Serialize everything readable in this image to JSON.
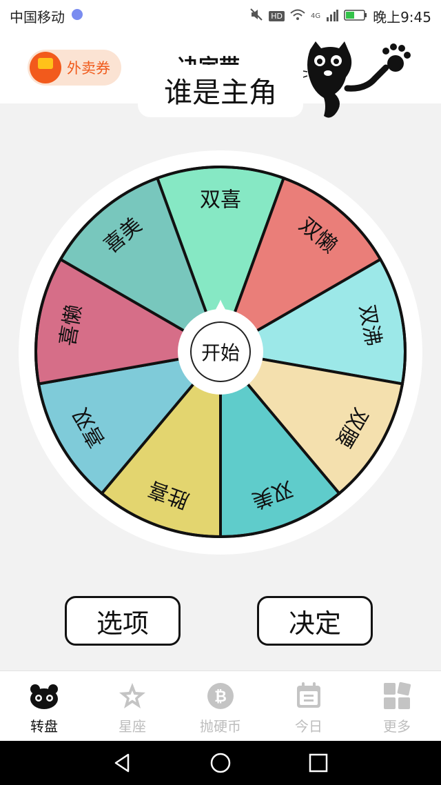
{
  "status_bar": {
    "carrier": "中国移动",
    "network": "4G",
    "time": "晚上9:45"
  },
  "header": {
    "coupon_label": "外卖券",
    "app_title": "决定带",
    "wheel_title": "谁是主角"
  },
  "wheel": {
    "segments": [
      {
        "label": "双喜",
        "color": "#86e8c4"
      },
      {
        "label": "双懒",
        "color": "#ea7e79"
      },
      {
        "label": "双沸",
        "color": "#9ce8e8"
      },
      {
        "label": "双腰",
        "color": "#f4e0ae"
      },
      {
        "label": "双美",
        "color": "#5fcccb"
      },
      {
        "label": "胜喜",
        "color": "#e3d56f"
      },
      {
        "label": "喜双",
        "color": "#7fcbd9"
      },
      {
        "label": "喜懒",
        "color": "#d66e88"
      },
      {
        "label": "喜美",
        "color": "#78c7bd"
      }
    ],
    "start_label": "开始"
  },
  "actions": {
    "options_label": "选项",
    "decide_label": "决定"
  },
  "tabs": [
    {
      "label": "转盘",
      "icon": "panda-icon",
      "active": true
    },
    {
      "label": "星座",
      "icon": "star-icon",
      "active": false
    },
    {
      "label": "抛硬币",
      "icon": "bitcoin-icon",
      "active": false
    },
    {
      "label": "今日",
      "icon": "calendar-icon",
      "active": false
    },
    {
      "label": "更多",
      "icon": "grid-icon",
      "active": false
    }
  ],
  "colors": {
    "accent": "#f05a1b",
    "page_bg": "#f2f2f2",
    "tab_inactive": "#bdbdbd"
  }
}
